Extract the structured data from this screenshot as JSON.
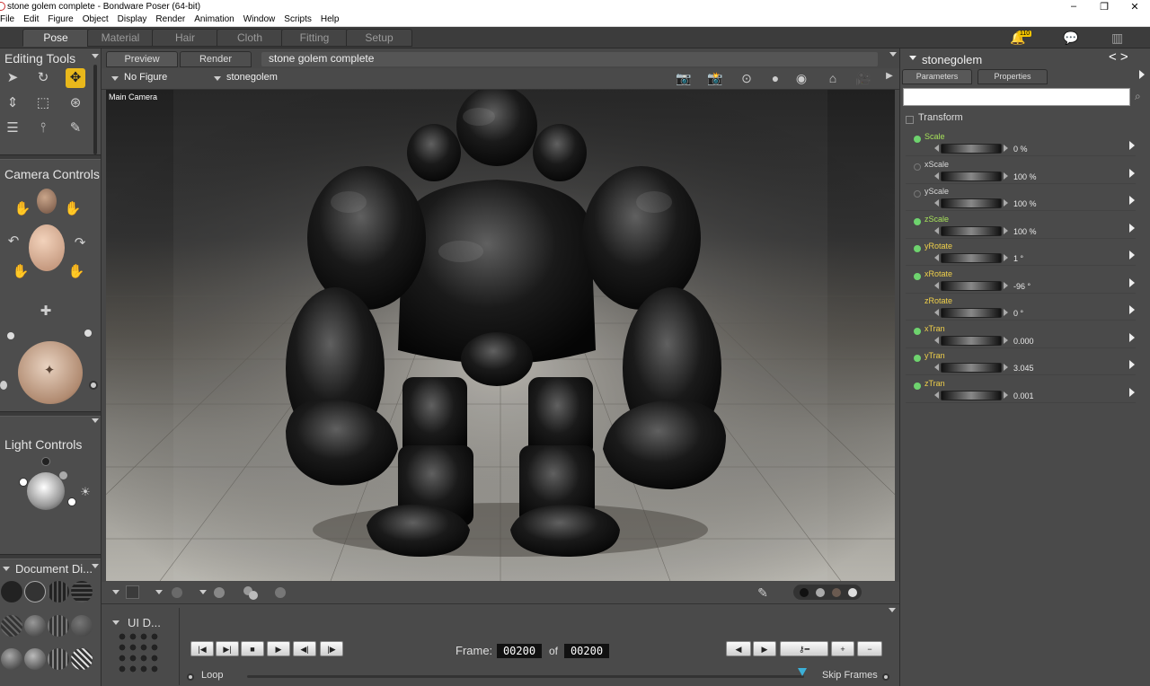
{
  "window": {
    "title": "stone golem complete - Bondware Poser (64-bit)",
    "minimize": "–",
    "maximize": "❐",
    "close": "✕"
  },
  "menu": [
    "File",
    "Edit",
    "Figure",
    "Object",
    "Display",
    "Render",
    "Animation",
    "Window",
    "Scripts",
    "Help"
  ],
  "rooms": [
    "Pose",
    "Material",
    "Hair",
    "Cloth",
    "Fitting",
    "Setup"
  ],
  "active_room": "Pose",
  "notifications_count": "110",
  "left_panel": {
    "editing_tools_title": "Editing Tools",
    "camera_controls_title": "Camera Controls",
    "light_controls_title": "Light Controls",
    "document_display_title": "Document  Di..."
  },
  "viewport": {
    "tabs": [
      "Preview",
      "Render"
    ],
    "document_title": "stone golem complete",
    "figure_selector": "No Figure",
    "actor_selector": "stonegolem",
    "camera_label": "Main Camera"
  },
  "timeline": {
    "ui_dots_label": "UI D...",
    "frame_label": "Frame:",
    "current_frame": "00200",
    "of_label": "of",
    "total_frames": "00200",
    "loop_label": "Loop",
    "skip_frames_label": "Skip Frames"
  },
  "right_panel": {
    "actor_name": "stonegolem",
    "tabs": [
      "Parameters",
      "Properties"
    ],
    "group_title": "Transform",
    "parameters": [
      {
        "name": "Scale",
        "value": "0 %",
        "color": "#a6e05a",
        "dot": "#6ed36e"
      },
      {
        "name": "xScale",
        "value": "100 %",
        "color": "#d8d8d8",
        "dot": "none"
      },
      {
        "name": "yScale",
        "value": "100 %",
        "color": "#d8d8d8",
        "dot": "none"
      },
      {
        "name": "zScale",
        "value": "100 %",
        "color": "#a6e05a",
        "dot": "#6ed36e"
      },
      {
        "name": "yRotate",
        "value": "1 °",
        "color": "#f0d04a",
        "dot": "#6ed36e"
      },
      {
        "name": "xRotate",
        "value": "-96 °",
        "color": "#f0d04a",
        "dot": "#6ed36e"
      },
      {
        "name": "zRotate",
        "value": "0 °",
        "color": "#f0d04a",
        "dot": "hidden"
      },
      {
        "name": "xTran",
        "value": "0.000",
        "color": "#f0d04a",
        "dot": "#6ed36e"
      },
      {
        "name": "yTran",
        "value": "3.045",
        "color": "#f0d04a",
        "dot": "#6ed36e"
      },
      {
        "name": "zTran",
        "value": "0.001",
        "color": "#f0d04a",
        "dot": "#6ed36e"
      }
    ]
  },
  "colors": {
    "accent": "#e9b81b",
    "panel": "#4a4a4a",
    "active_dot": "#6ed36e"
  }
}
